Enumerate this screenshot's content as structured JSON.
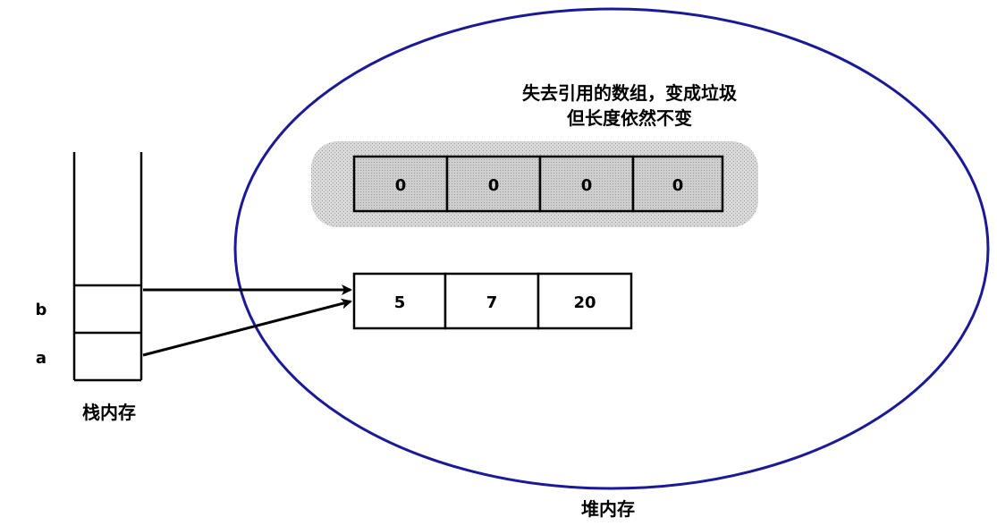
{
  "stack": {
    "label": "栈内存",
    "var_b": "b",
    "var_a": "a"
  },
  "heap": {
    "label": "堆内存",
    "note_line1": "失去引用的数组，变成垃圾",
    "note_line2": "但长度依然不变"
  },
  "garbage_array": {
    "cells": [
      "0",
      "0",
      "0",
      "0"
    ]
  },
  "live_array": {
    "cells": [
      "5",
      "7",
      "20"
    ]
  },
  "colors": {
    "ellipse": "#1a1a99",
    "garbage_bg": "#c8c8c8",
    "garbage_cell": "#d6d6d6",
    "line": "#000000"
  }
}
